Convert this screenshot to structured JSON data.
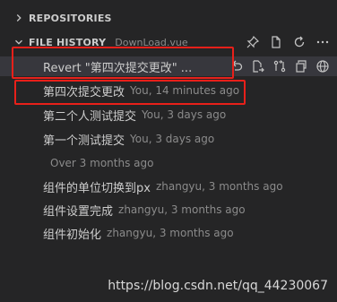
{
  "sections": {
    "repositories": {
      "label": "REPOSITORIES"
    },
    "file_history": {
      "label": "FILE HISTORY",
      "file": "DownLoad.vue"
    }
  },
  "commits": [
    {
      "title": "Revert \"第四次提交更改\" ...",
      "description": ""
    },
    {
      "title": "第四次提交更改",
      "description": "You, 14 minutes ago"
    },
    {
      "title": "第二个人测试提交",
      "description": "You, 3 days ago"
    },
    {
      "title": "第一个测试提交",
      "description": "You, 3 days ago"
    }
  ],
  "group": {
    "label": "Over 3 months ago"
  },
  "old_commits": [
    {
      "title": "组件的单位切换到px",
      "description": "zhangyu, 3 months ago"
    },
    {
      "title": "组件设置完成",
      "description": "zhangyu, 3 months ago"
    },
    {
      "title": "组件初始化",
      "description": "zhangyu, 3 months ago"
    }
  ],
  "icons": {
    "header": [
      "pin-icon",
      "new-file-icon",
      "refresh-icon",
      "more-icon"
    ],
    "row": [
      "undo-icon",
      "open-changes-icon",
      "compare-icon",
      "copy-icon",
      "globe-icon"
    ]
  },
  "watermark": "https://blog.csdn.net/qq_44230067",
  "colors": {
    "highlight": "#e8201a",
    "background": "#252526",
    "selected": "#37373d"
  }
}
